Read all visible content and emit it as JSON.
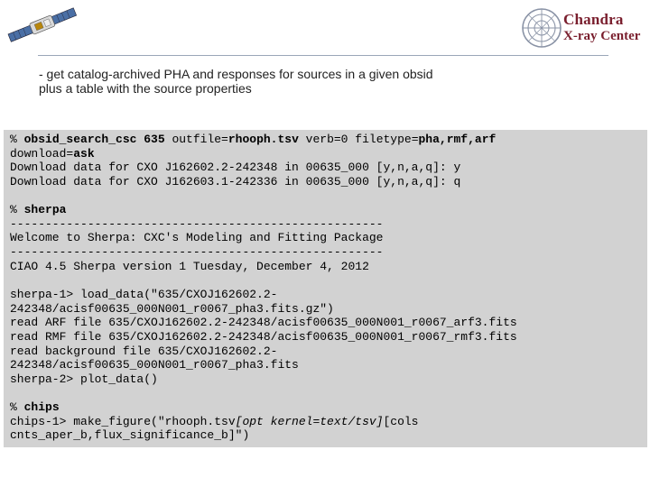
{
  "header": {
    "logo_line1": "Chandra",
    "logo_line2": "X-ray Center"
  },
  "intro": {
    "line1": "- get catalog-archived PHA and responses for sources in a given obsid",
    "line2": "plus a table with the source properties"
  },
  "terminal": {
    "cmd1": {
      "prompt": "% ",
      "tool": "obsid_search_csc 635",
      "mid1": " outfile=",
      "outfile": "rhooph.tsv",
      "mid2": " verb=0 filetype=",
      "filetype": "pha,rmf,arf"
    },
    "download_prefix": "download=",
    "download_value": "ask",
    "dl1": "Download data for CXO J162602.2-242348 in 00635_000 [y,n,a,q]: y",
    "dl2": "Download data for CXO J162603.1-242336 in 00635_000 [y,n,a,q]: q",
    "cmd2_prompt": "% ",
    "cmd2": "sherpa",
    "sep1": "-----------------------------------------------------",
    "welcome": "Welcome to Sherpa: CXC's Modeling and Fitting Package",
    "sep2": "-----------------------------------------------------",
    "version": "CIAO 4.5 Sherpa version 1 Tuesday, December 4, 2012",
    "s1": "sherpa-1> load_data(\"635/CXOJ162602.2-",
    "s2": "242348/acisf00635_000N001_r0067_pha3.fits.gz\")",
    "s3": "read ARF file 635/CXOJ162602.2-242348/acisf00635_000N001_r0067_arf3.fits",
    "s4": "read RMF file 635/CXOJ162602.2-242348/acisf00635_000N001_r0067_rmf3.fits",
    "s5": "read background file 635/CXOJ162602.2-",
    "s6": "242348/acisf00635_000N001_r0067_pha3.fits",
    "s7": "sherpa-2> plot_data()",
    "cmd3_prompt": "% ",
    "cmd3": "chips",
    "c1_pre": "chips-1> make_figure(\"rhooph.tsv",
    "c1_italic": "[opt kernel=text/tsv]",
    "c1_post": "[cols",
    "c2": "cnts_aper_b,flux_significance_b]\")"
  }
}
